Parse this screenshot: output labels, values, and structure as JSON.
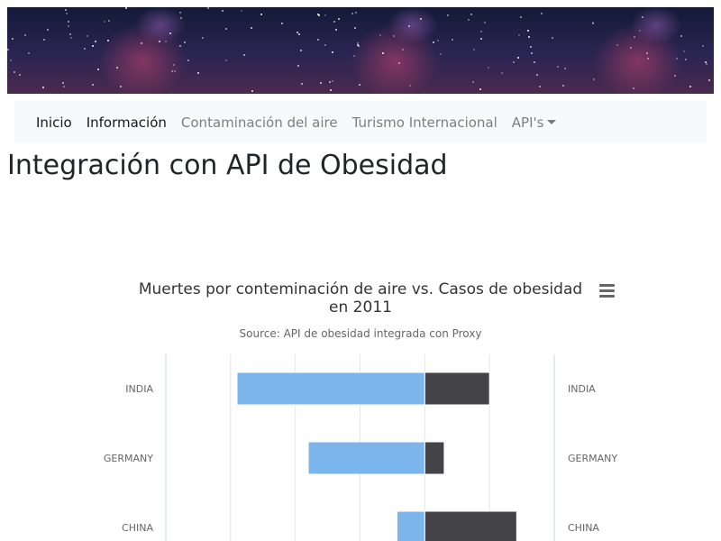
{
  "nav": {
    "items": [
      {
        "label": "Inicio",
        "active": true
      },
      {
        "label": "Información",
        "active": true
      },
      {
        "label": "Contaminación del aire",
        "active": false
      },
      {
        "label": "Turismo Internacional",
        "active": false
      },
      {
        "label": "API's",
        "active": false,
        "dropdown": true
      }
    ]
  },
  "page": {
    "title": "Integración con API de Obesidad"
  },
  "icons": {
    "chart_menu": "hamburger-menu-icon",
    "nav_dropdown": "caret-down-icon"
  },
  "chart_data": {
    "type": "bar",
    "orientation": "horizontal",
    "stacking": "diverging",
    "title_lines": [
      "Muertes por conteminación de aire vs. Casos de obesidad",
      "en 2011"
    ],
    "subtitle": "Source: API de obesidad integrada con Proxy",
    "categories": [
      "INDIA",
      "GERMANY",
      "CHINA"
    ],
    "series": [
      {
        "values": [
          -29,
          -18,
          -4.3
        ],
        "color": "#7cb5ec"
      },
      {
        "values": [
          10,
          3,
          14.2
        ],
        "color": "#434348"
      }
    ],
    "xlim": [
      -40,
      20
    ],
    "x_grid_step": 10,
    "grid": true
  }
}
